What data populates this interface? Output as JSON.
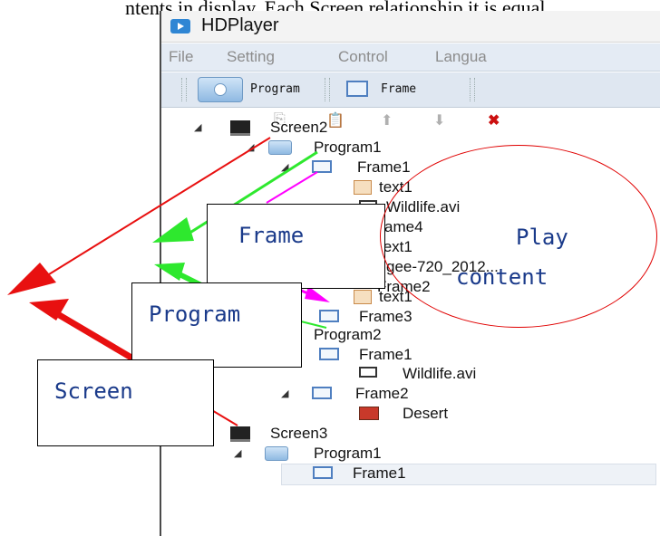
{
  "caption": "ntents in display. Each Screen relationship it is equal.",
  "window": {
    "title": "HDPlayer",
    "menus": [
      "File",
      "Setting",
      "Control",
      "Langua"
    ],
    "toolbar": {
      "program_label": "Program",
      "frame_label": "Frame"
    }
  },
  "tree": [
    {
      "label": "Screen2",
      "icon": "screen-icon"
    },
    {
      "label": "Program1",
      "icon": "program-icon"
    },
    {
      "label": "Frame1",
      "icon": "frame-icon"
    },
    {
      "label": "text1",
      "icon": "text-icon"
    },
    {
      "label": "Wildlife.avi",
      "icon": "video-icon"
    },
    {
      "label": "Frame4",
      "icon": "frame-icon"
    },
    {
      "label": "text1",
      "icon": "text-icon"
    },
    {
      "label": "gee-720_2012...",
      "icon": "video-icon"
    },
    {
      "label": "Frame2",
      "icon": "frame-icon"
    },
    {
      "label": "text1",
      "icon": "text-icon"
    },
    {
      "label": "Frame3",
      "icon": "frame-icon"
    },
    {
      "label": "Program2",
      "icon": "program-icon"
    },
    {
      "label": "Frame1",
      "icon": "frame-icon"
    },
    {
      "label": "Wildlife.avi",
      "icon": "video-icon"
    },
    {
      "label": "Frame2",
      "icon": "frame-icon"
    },
    {
      "label": "Desert",
      "icon": "image-icon"
    },
    {
      "label": "Screen3",
      "icon": "screen-icon"
    },
    {
      "label": "Program1",
      "icon": "program-icon"
    },
    {
      "label": "Frame1",
      "icon": "frame-icon"
    }
  ],
  "labels": {
    "frame": "Frame",
    "program": "Program",
    "screen": "Screen",
    "play_line1": "Play",
    "play_line2": "content"
  },
  "colors": {
    "screen_arrow": "#e81010",
    "program_arrow": "#2ee82e",
    "frame_arrow": "#ff00ff",
    "ellipse": "#e00000",
    "label_text": "#1a3a8a"
  }
}
